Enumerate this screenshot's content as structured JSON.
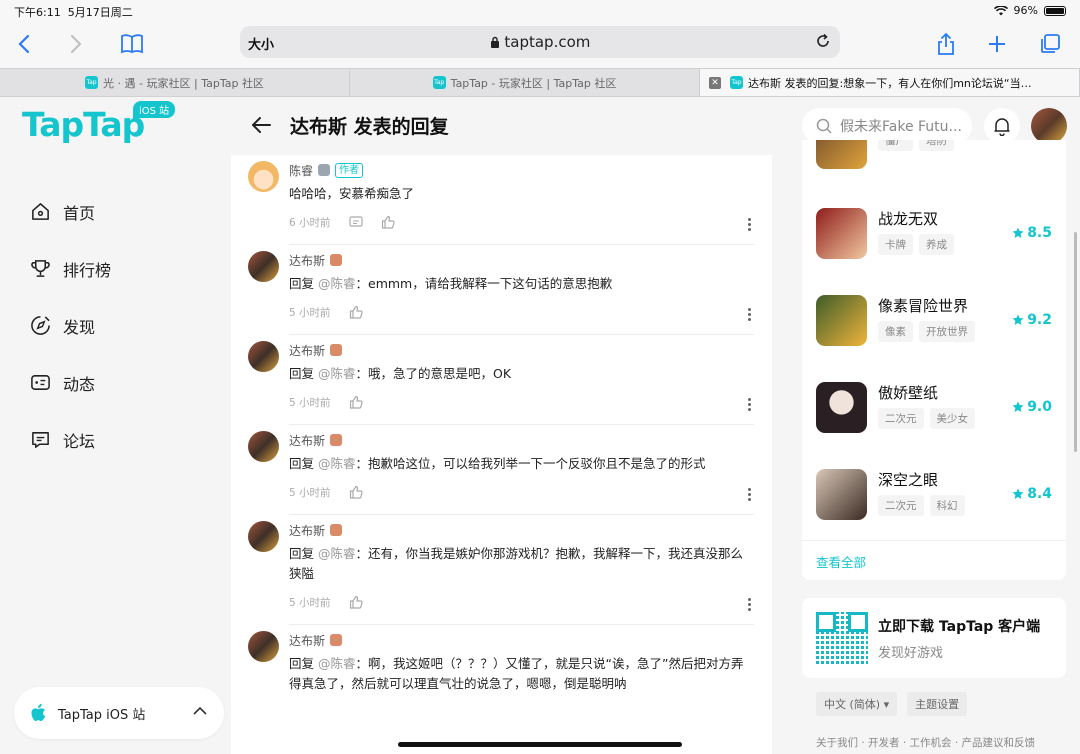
{
  "status_bar": {
    "time": "下午6:11",
    "date": "5月17日周二",
    "battery": "96%"
  },
  "browser": {
    "text_size": "大小",
    "url": "taptap.com",
    "tabs": [
      {
        "title": "光 · 遇 - 玩家社区 | TapTap 社区",
        "active": false
      },
      {
        "title": "TapTap - 玩家社区 | TapTap 社区",
        "active": false
      },
      {
        "title": "达布斯 发表的回复:想象一下，有人在你们mn论坛说“当…",
        "active": true
      }
    ],
    "favicon_text": "Tap"
  },
  "sidebar": {
    "logo": "TapTap",
    "logo_badge": "iOS 站",
    "nav": [
      {
        "label": "首页",
        "icon": "home-icon"
      },
      {
        "label": "排行榜",
        "icon": "trophy-icon"
      },
      {
        "label": "发现",
        "icon": "discover-icon"
      },
      {
        "label": "动态",
        "icon": "feed-icon"
      },
      {
        "label": "论坛",
        "icon": "forum-icon"
      }
    ],
    "ios_site_label": "TapTap iOS 站"
  },
  "header": {
    "title": "达布斯 发表的回复",
    "search_placeholder": "假未来Fake Futu..."
  },
  "comments": [
    {
      "author": "陈睿",
      "author_tag": "作者",
      "reply_prefix": "",
      "reply_to": "",
      "text": "哈哈哈，安慕希痴急了",
      "time": "6 小时前",
      "has_reply_icon": true,
      "avatar": "anime"
    },
    {
      "author": "达布斯",
      "author_tag": "",
      "reply_prefix": "回复 ",
      "reply_to": "@陈睿",
      "text": "：emmm，请给我解释一下这句话的意思抱歉",
      "time": "5 小时前",
      "has_reply_icon": false,
      "avatar": "user"
    },
    {
      "author": "达布斯",
      "author_tag": "",
      "reply_prefix": "回复 ",
      "reply_to": "@陈睿",
      "text": "：哦，急了的意思是吧，OK",
      "time": "5 小时前",
      "has_reply_icon": false,
      "avatar": "user"
    },
    {
      "author": "达布斯",
      "author_tag": "",
      "reply_prefix": "回复 ",
      "reply_to": "@陈睿",
      "text": "：抱歉哈这位，可以给我列举一下一个反驳你且不是急了的形式",
      "time": "5 小时前",
      "has_reply_icon": false,
      "avatar": "user"
    },
    {
      "author": "达布斯",
      "author_tag": "",
      "reply_prefix": "回复 ",
      "reply_to": "@陈睿",
      "text": "：还有，你当我是嫉妒你那游戏机？抱歉，我解释一下，我还真没那么狭隘",
      "time": "5 小时前",
      "has_reply_icon": false,
      "avatar": "user"
    },
    {
      "author": "达布斯",
      "author_tag": "",
      "reply_prefix": "回复 ",
      "reply_to": "@陈睿",
      "text": "：啊，我这姬吧（？？？）又懂了，就是只说“诶，急了”然后把对方弄得真急了，然后就可以理直气壮的说急了，嗯嗯，倒是聪明呐",
      "time": "",
      "has_reply_icon": false,
      "avatar": "user"
    }
  ],
  "games": {
    "partial_tags": [
      "僵尸",
      "塔防"
    ],
    "items": [
      {
        "name": "战龙无双",
        "tags": [
          "卡牌",
          "养成"
        ],
        "rating": "8.5",
        "colors": [
          "#8e1c1c",
          "#f2c9a0"
        ]
      },
      {
        "name": "像素冒险世界",
        "tags": [
          "像素",
          "开放世界"
        ],
        "rating": "9.2",
        "colors": [
          "#3e5c2a",
          "#f0b43c"
        ]
      },
      {
        "name": "傲娇壁纸",
        "tags": [
          "二次元",
          "美少女"
        ],
        "rating": "9.0",
        "colors": [
          "#efe3dc",
          "#2a2024"
        ]
      },
      {
        "name": "深空之眼",
        "tags": [
          "二次元",
          "科幻"
        ],
        "rating": "8.4",
        "colors": [
          "#d9c8b8",
          "#3a2a22"
        ]
      }
    ],
    "see_all": "查看全部"
  },
  "download": {
    "title": "立即下载 TapTap 客户端",
    "subtitle": "发现好游戏"
  },
  "footer": {
    "language": "中文 (简体) ▾",
    "theme": "主题设置",
    "links": "关于我们 · 开发者 · 工作机会 · 产品建议和反馈"
  },
  "colors": {
    "accent": "#15c5ce",
    "browser_blue": "#2b7bf6"
  }
}
